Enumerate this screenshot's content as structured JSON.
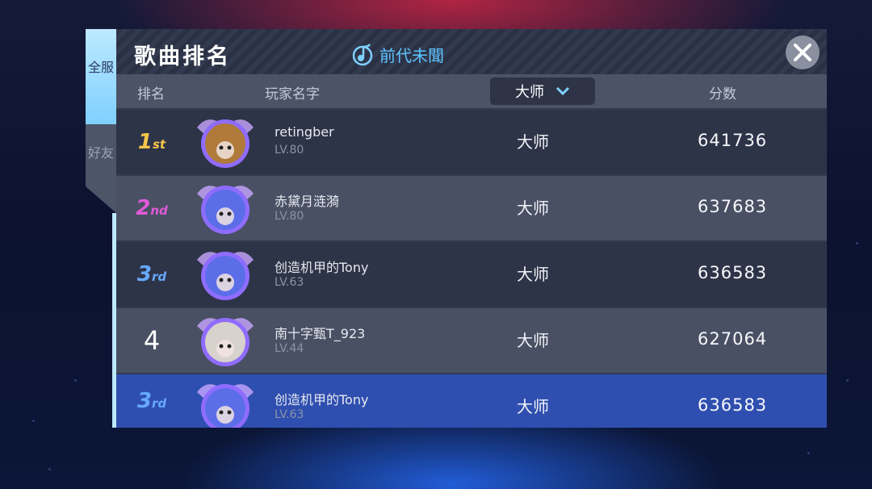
{
  "tabs": {
    "all": "全服",
    "friends": "好友"
  },
  "header": {
    "title": "歌曲排名",
    "song": "前代未聞"
  },
  "columns": {
    "rank": "排名",
    "player": "玩家名字",
    "difficulty": "大师",
    "score": "分数"
  },
  "rows": [
    {
      "rank_num": "1",
      "rank_suffix": "st",
      "name": "retingber",
      "level": "LV.80",
      "difficulty": "大师",
      "score": "641736",
      "rank_color": "#f3c54a",
      "avatar": "cat-avatar"
    },
    {
      "rank_num": "2",
      "rank_suffix": "nd",
      "name": "赤黛月涟漪",
      "level": "LV.80",
      "difficulty": "大师",
      "score": "637683",
      "rank_color": "#e05ad8",
      "avatar": "blue-hair-avatar"
    },
    {
      "rank_num": "3",
      "rank_suffix": "rd",
      "name": "创造机甲的Tony",
      "level": "LV.63",
      "difficulty": "大师",
      "score": "636583",
      "rank_color": "#66a9ff",
      "avatar": "blue-hair-avatar"
    },
    {
      "rank_num": "4",
      "rank_suffix": "",
      "name": "南十字甄T_923",
      "level": "LV.44",
      "difficulty": "大师",
      "score": "627064",
      "rank_color": "#ffffff",
      "avatar": "white-cat-avatar"
    },
    {
      "rank_num": "3",
      "rank_suffix": "rd",
      "name": "创造机甲的Tony",
      "level": "LV.63",
      "difficulty": "大师",
      "score": "636583",
      "rank_color": "#66a9ff",
      "avatar": "blue-hair-avatar",
      "self": true
    }
  ]
}
